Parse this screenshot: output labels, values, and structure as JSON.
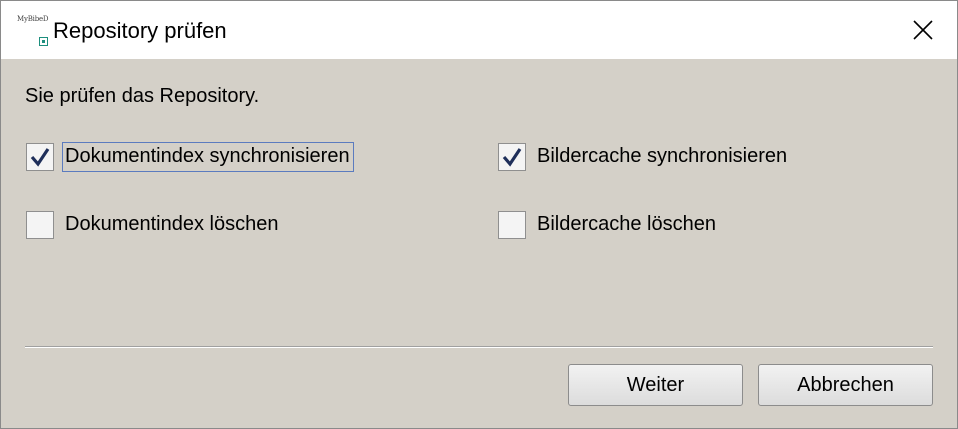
{
  "window": {
    "title": "Repository prüfen",
    "app_icon": {
      "icon": "app-logo-icon",
      "text": "MyBibeD"
    },
    "close_icon": "close-icon"
  },
  "content": {
    "intro": "Sie prüfen das Repository.",
    "options": [
      {
        "label": "Dokumentindex synchronisieren",
        "checked": true,
        "focused": true
      },
      {
        "label": "Bildercache synchronisieren",
        "checked": true,
        "focused": false
      },
      {
        "label": "Dokumentindex löschen",
        "checked": false,
        "focused": false
      },
      {
        "label": "Bildercache löschen",
        "checked": false,
        "focused": false
      }
    ]
  },
  "buttons": {
    "next_label": "Weiter",
    "cancel_label": "Abbrechen"
  },
  "colors": {
    "dialog_background": "#d4d0c8",
    "checkmark": "#1f2f5a",
    "focus_border": "#5b7bbf"
  }
}
